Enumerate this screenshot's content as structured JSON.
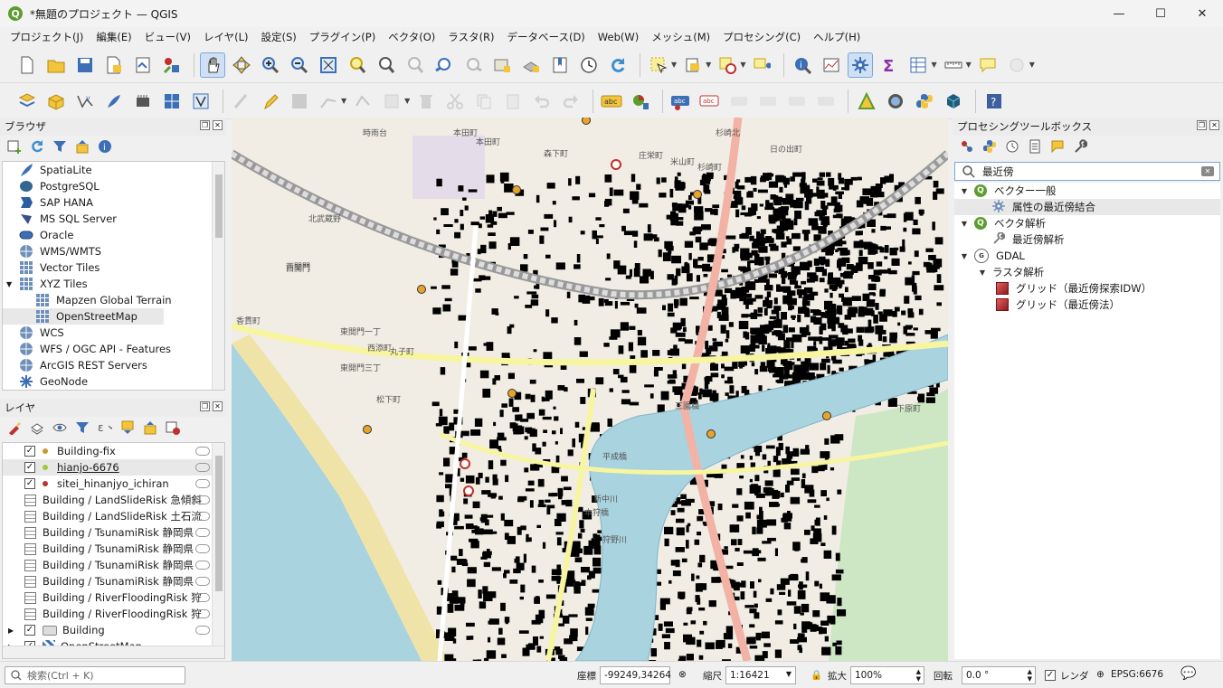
{
  "window": {
    "title": "*無題のプロジェクト — QGIS",
    "logo": "Q",
    "minimize": "—",
    "maximize": "☐",
    "close": "✕"
  },
  "menu": [
    "プロジェクト(J)",
    "編集(E)",
    "ビュー(V)",
    "レイヤ(L)",
    "設定(S)",
    "プラグイン(P)",
    "ベクタ(O)",
    "ラスタ(R)",
    "データベース(D)",
    "Web(W)",
    "メッシュ(M)",
    "プロセシング(C)",
    "ヘルプ(H)"
  ],
  "browser": {
    "title": "ブラウザ",
    "items": [
      {
        "label": "SpatiaLite",
        "icon": "feather-icon"
      },
      {
        "label": "PostgreSQL",
        "icon": "elephant-icon"
      },
      {
        "label": "SAP HANA",
        "icon": "hana-icon"
      },
      {
        "label": "MS SQL Server",
        "icon": "mssql-icon"
      },
      {
        "label": "Oracle",
        "icon": "oracle-icon"
      },
      {
        "label": "WMS/WMTS",
        "icon": "globe-icon"
      },
      {
        "label": "Vector Tiles",
        "icon": "grid-icon"
      },
      {
        "label": "XYZ Tiles",
        "icon": "grid-icon",
        "expanded": true
      },
      {
        "label": "Mapzen Global Terrain",
        "icon": "grid-icon",
        "indent": true
      },
      {
        "label": "OpenStreetMap",
        "icon": "grid-icon",
        "indent": true,
        "selected": true
      },
      {
        "label": "WCS",
        "icon": "globe-icon"
      },
      {
        "label": "WFS / OGC API - Features",
        "icon": "globe-icon"
      },
      {
        "label": "ArcGIS REST Servers",
        "icon": "globe-icon"
      },
      {
        "label": "GeoNode",
        "icon": "geonode-icon"
      }
    ]
  },
  "layers": {
    "title": "レイヤ",
    "items": [
      {
        "label": "Building-fix",
        "checked": true,
        "dot": "#c79a2e"
      },
      {
        "label": "hianjo-6676",
        "checked": true,
        "dot": "#9ccc3b",
        "selected": true,
        "underline": true
      },
      {
        "label": "sitei_hinanjyo_ichiran",
        "checked": true,
        "dot": "#c0302c"
      },
      {
        "label": "Building / LandSlideRisk 急傾斜",
        "table": true
      },
      {
        "label": "Building / LandSlideRisk 土石流",
        "table": true
      },
      {
        "label": "Building / TsunamiRisk 静岡県",
        "table": true
      },
      {
        "label": "Building / TsunamiRisk 静岡県",
        "table": true
      },
      {
        "label": "Building / TsunamiRisk 静岡県",
        "table": true
      },
      {
        "label": "Building / TsunamiRisk 静岡県",
        "table": true
      },
      {
        "label": "Building / RiverFloodingRisk 狩",
        "table": true
      },
      {
        "label": "Building / RiverFloodingRisk 狩",
        "table": true
      },
      {
        "label": "Building",
        "checked": true,
        "group": true
      },
      {
        "label": "OpenStreetMap",
        "checked": true,
        "group": true
      }
    ]
  },
  "map": {
    "labels": [
      "本田町",
      "時雨台",
      "本田町",
      "森下町",
      "庄栄町",
      "米山町",
      "杉崎町",
      "杉崎北",
      "日の出町",
      "西開門",
      "西間門",
      "北武蔵野",
      "香貫町",
      "東間門一丁",
      "西添町",
      "丸子町",
      "東開門三丁",
      "松下町",
      "三園橋",
      "平成橋",
      "本狩橋",
      "下原町",
      "新中川",
      "狩野川"
    ]
  },
  "processing": {
    "title": "プロセシングツールボックス",
    "search": "最近傍",
    "tree": [
      {
        "label": "ベクター一般",
        "level": 0,
        "icon": "qgis",
        "expanded": true
      },
      {
        "label": "属性の最近傍結合",
        "level": 1,
        "icon": "gear",
        "selected": true
      },
      {
        "label": "ベクタ解析",
        "level": 0,
        "icon": "qgis",
        "expanded": true
      },
      {
        "label": "最近傍解析",
        "level": 1,
        "icon": "wrench"
      },
      {
        "label": "GDAL",
        "level": 0,
        "icon": "gdal",
        "expanded": true
      },
      {
        "label": "ラスタ解析",
        "level": 1,
        "icon": "none",
        "expanded": true
      },
      {
        "label": "グリッド（最近傍探索IDW）",
        "level": 2,
        "icon": "red"
      },
      {
        "label": "グリッド（最近傍法）",
        "level": 2,
        "icon": "red"
      }
    ]
  },
  "status": {
    "search_placeholder": "検索(Ctrl + K)",
    "coord_label": "座標",
    "coord": "-99249,34264",
    "scale_label": "縮尺",
    "scale": "1:16421",
    "magnifier_label": "拡大",
    "magnifier": "100%",
    "rotation_label": "回転",
    "rotation": "0.0 °",
    "render_label": "レンダ",
    "crs": "EPSG:6676"
  },
  "colors": {
    "accent": "#5b9d2e",
    "selection": "#cfe0f5",
    "sea": "#a9d3df",
    "river": "#a9d3df",
    "beach": "#f0e3a8",
    "primary_road": "#f2b2a6",
    "secondary_road": "#f7f5a0",
    "park": "#cde6c4",
    "building": "#000000"
  }
}
